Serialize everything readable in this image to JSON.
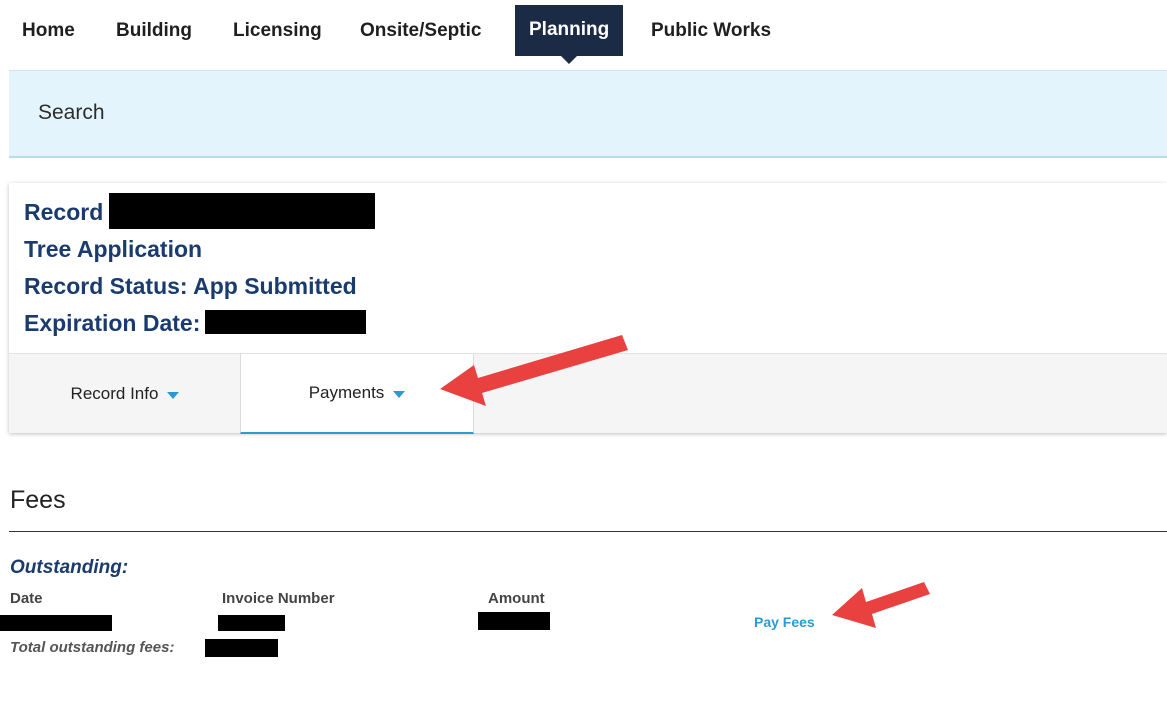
{
  "nav": {
    "items": [
      {
        "label": "Home"
      },
      {
        "label": "Building"
      },
      {
        "label": "Licensing"
      },
      {
        "label": "Onsite/Septic"
      },
      {
        "label": "Planning"
      },
      {
        "label": "Public Works"
      }
    ],
    "active": "Planning"
  },
  "search": {
    "label": "Search"
  },
  "record": {
    "record_label": "Record",
    "type": "Tree Application",
    "status": "Record Status: App Submitted",
    "expiration_label": "Expiration Date:"
  },
  "tabs": [
    {
      "label": "Record Info"
    },
    {
      "label": "Payments"
    }
  ],
  "fees": {
    "title": "Fees",
    "outstanding_label": "Outstanding:",
    "columns": [
      "Date",
      "Invoice Number",
      "Amount"
    ],
    "pay_fees_label": "Pay Fees",
    "total_label": "Total outstanding fees:"
  },
  "colors": {
    "nav_active_bg": "#1c2b45",
    "record_text": "#1a3b6e",
    "accent_blue": "#2b9ad3",
    "search_bg": "#e4f4fc",
    "annotation_arrow": "#e8413f"
  }
}
